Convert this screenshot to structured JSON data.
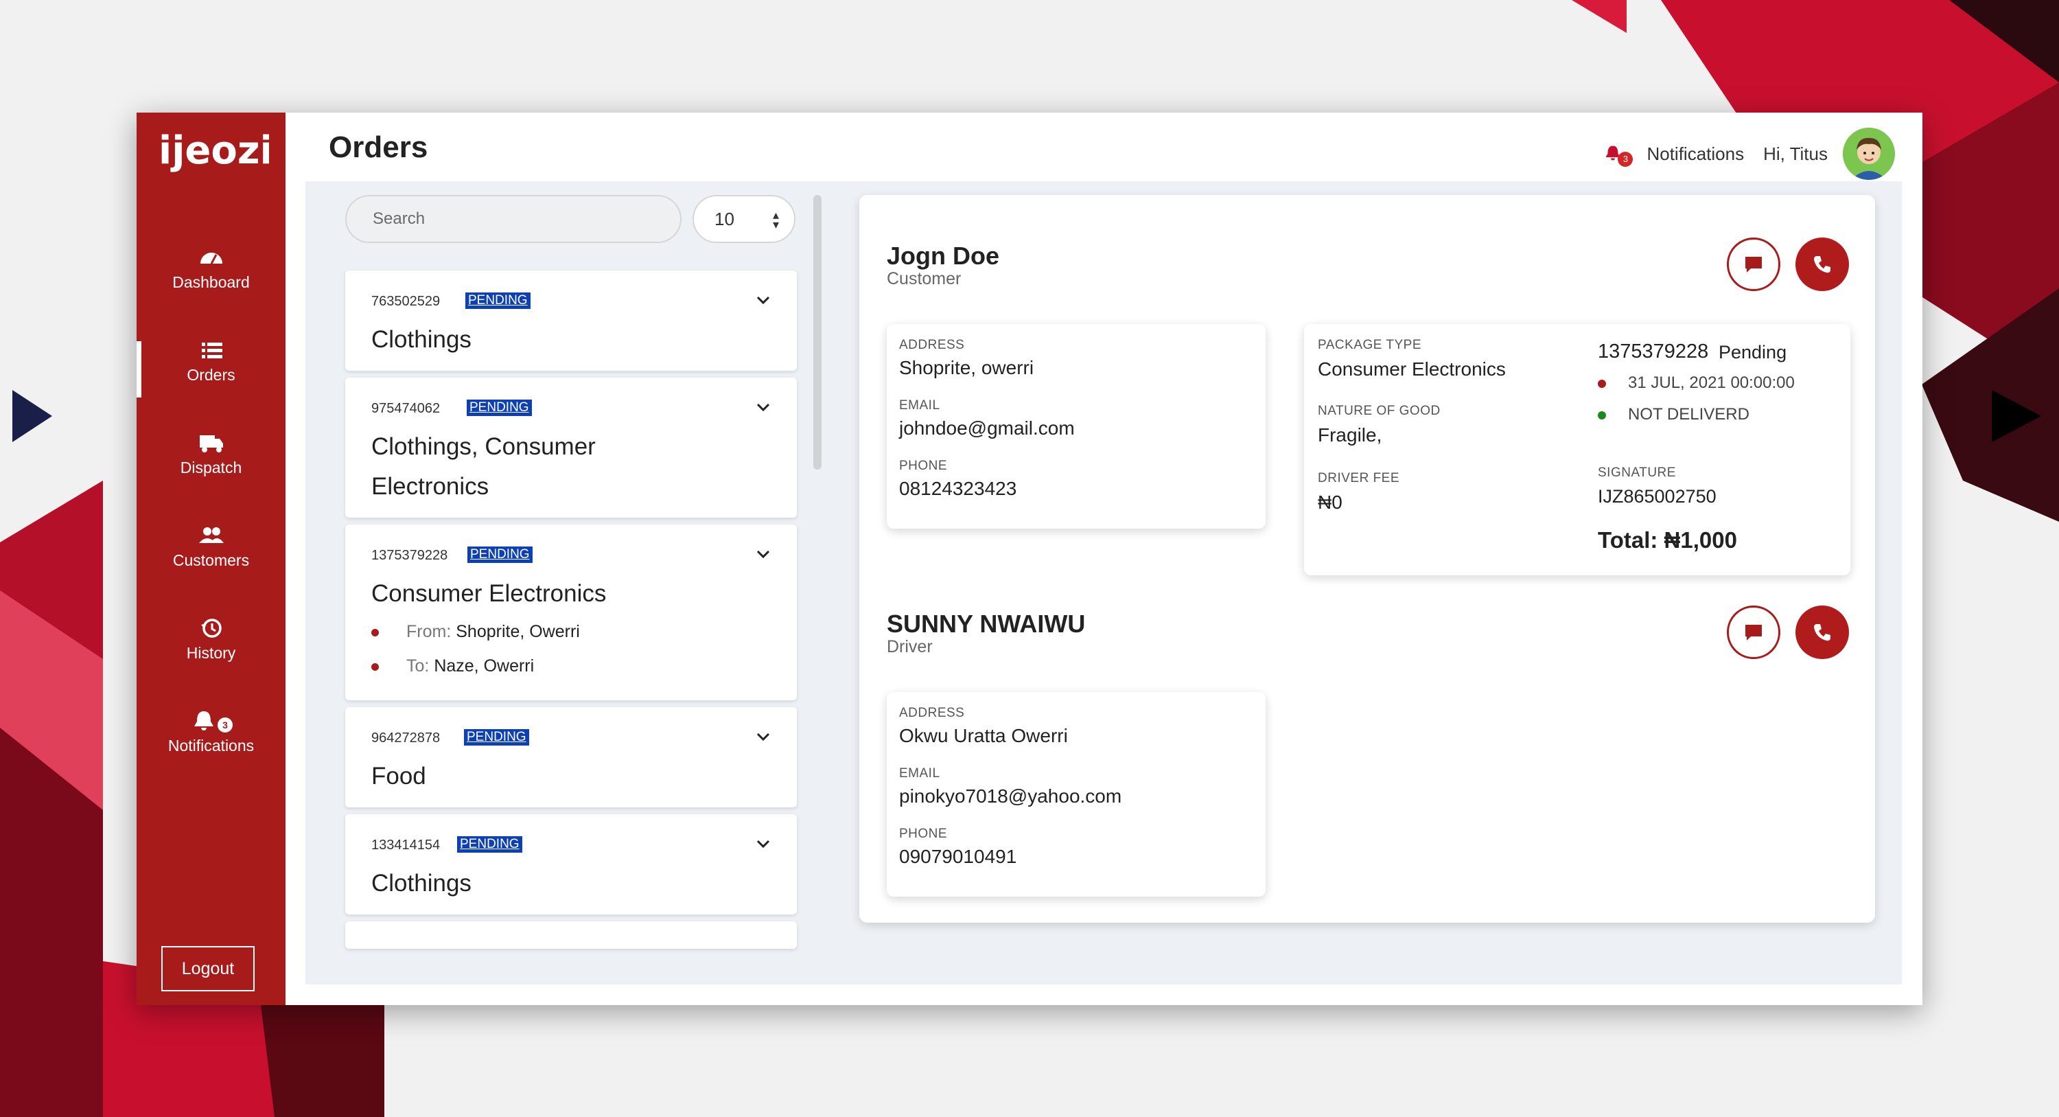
{
  "app": {
    "logo_text": "ijeozi",
    "page_title": "Orders"
  },
  "colors": {
    "brand": "#a71b1b",
    "badge": "#0d3fb5",
    "status_pending": "#a71b1b",
    "status_ok": "#1a8a1a",
    "accent_dark": "#1a1f4a"
  },
  "sidebar": {
    "items": [
      {
        "label": "Dashboard",
        "icon": "dashboard-icon"
      },
      {
        "label": "Orders",
        "icon": "list-icon"
      },
      {
        "label": "Dispatch",
        "icon": "truck-icon"
      },
      {
        "label": "Customers",
        "icon": "users-icon"
      },
      {
        "label": "History",
        "icon": "history-icon"
      },
      {
        "label": "Notifications",
        "icon": "bell-icon",
        "badge": "3"
      }
    ],
    "logout_label": "Logout"
  },
  "topbar": {
    "notif_count": "3",
    "notif_label": "Notifications",
    "greeting": "Hi, Titus"
  },
  "list": {
    "search_placeholder": "Search",
    "page_size": "10",
    "orders": [
      {
        "id": "763502529",
        "status": "PENDING",
        "title": "Clothings"
      },
      {
        "id": "975474062",
        "status": "PENDING",
        "title": "Clothings, Consumer Electronics"
      },
      {
        "id": "1375379228",
        "status": "PENDING",
        "title": "Consumer Electronics",
        "from_label": "From:",
        "from": "Shoprite, Owerri",
        "to_label": "To:",
        "to": "Naze, Owerri"
      },
      {
        "id": "964272878",
        "status": "PENDING",
        "title": "Food"
      },
      {
        "id": "133414154",
        "status": "PENDING",
        "title": "Clothings"
      }
    ]
  },
  "customer": {
    "name": "Jogn Doe",
    "role": "Customer",
    "address_label": "ADDRESS",
    "address": "Shoprite, owerri",
    "email_label": "EMAIL",
    "email": "johndoe@gmail.com",
    "phone_label": "PHONE",
    "phone": "08124323423"
  },
  "package": {
    "type_label": "PACKAGE TYPE",
    "type": "Consumer Electronics",
    "nature_label": "NATURE OF GOOD",
    "nature": "Fragile,",
    "fee_label": "DRIVER FEE",
    "fee": "₦0",
    "order_id": "1375379228",
    "order_status": "Pending",
    "date": "31 JUL, 2021 00:00:00",
    "delivery_status": "NOT DELIVERD",
    "signature_label": "SIGNATURE",
    "signature": "IJZ865002750",
    "total": "Total: ₦1,000"
  },
  "driver": {
    "name": "SUNNY NWAIWU",
    "role": "Driver",
    "address_label": "ADDRESS",
    "address": "Okwu Uratta Owerri",
    "email_label": "EMAIL",
    "email": "pinokyo7018@yahoo.com",
    "phone_label": "PHONE",
    "phone": "09079010491"
  }
}
